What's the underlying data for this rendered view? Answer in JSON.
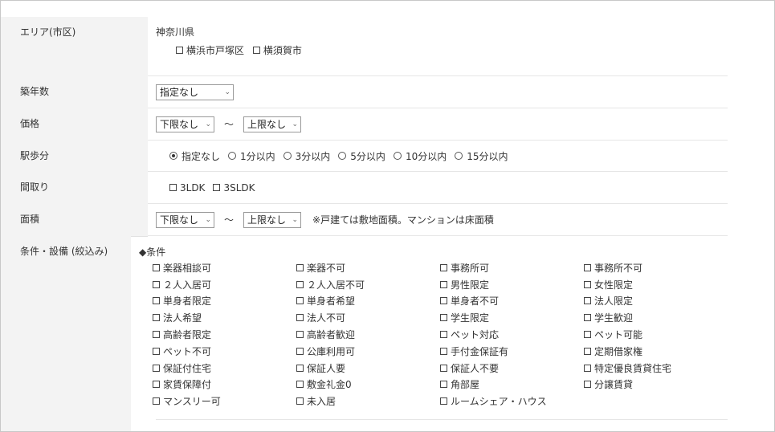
{
  "area": {
    "label": "エリア(市区)",
    "prefecture": "神奈川県",
    "cities": [
      "横浜市戸塚区",
      "横須賀市"
    ]
  },
  "age": {
    "label": "築年数",
    "select_value": "指定なし"
  },
  "price": {
    "label": "価格",
    "min_value": "下限なし",
    "max_value": "上限なし",
    "tilde": "～"
  },
  "walk": {
    "label": "駅歩分",
    "options": [
      "指定なし",
      "1分以内",
      "3分以内",
      "5分以内",
      "10分以内",
      "15分以内"
    ],
    "selected": "指定なし"
  },
  "layout": {
    "label": "間取り",
    "options": [
      "3LDK",
      "3SLDK"
    ]
  },
  "area_size": {
    "label": "面積",
    "min_value": "下限なし",
    "max_value": "上限なし",
    "tilde": "～",
    "note": "※戸建ては敷地面積。マンションは床面積"
  },
  "conditions": {
    "label": "条件・設備 (絞込み)",
    "heading": "◆条件",
    "items": [
      "楽器相談可",
      "楽器不可",
      "事務所可",
      "事務所不可",
      "２人入居可",
      "２人入居不可",
      "男性限定",
      "女性限定",
      "単身者限定",
      "単身者希望",
      "単身者不可",
      "法人限定",
      "法人希望",
      "法人不可",
      "学生限定",
      "学生歓迎",
      "高齢者限定",
      "高齢者歓迎",
      "ペット対応",
      "ペット可能",
      "ペット不可",
      "公庫利用可",
      "手付金保証有",
      "定期借家権",
      "保証付住宅",
      "保証人要",
      "保証人不要",
      "特定優良賃貸住宅",
      "家賃保障付",
      "敷金礼金0",
      "角部屋",
      "分譲賃貸",
      "マンスリー可",
      "未入居",
      "ルームシェア・ハウス"
    ]
  }
}
